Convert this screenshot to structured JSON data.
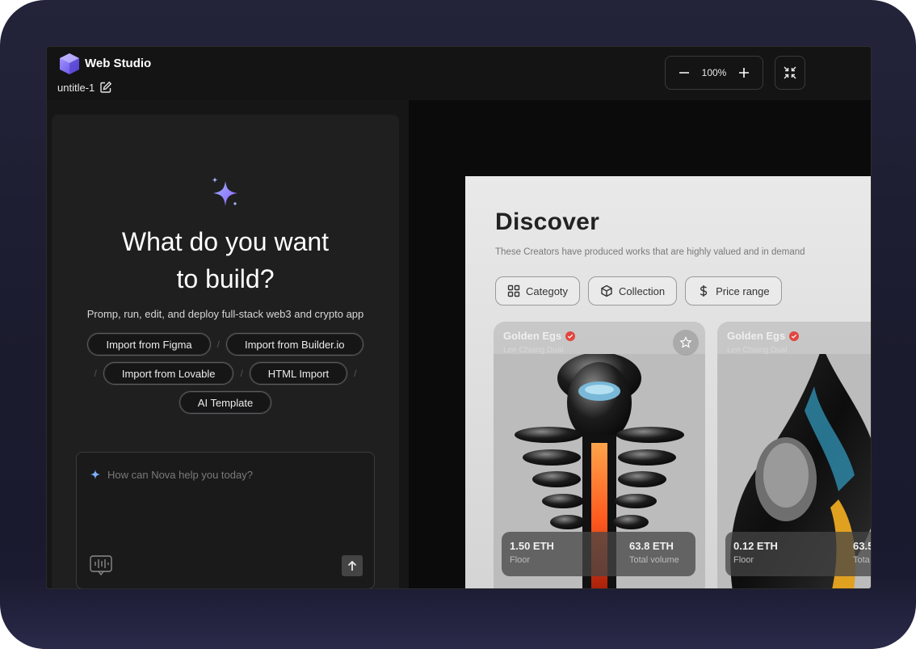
{
  "app": {
    "title": "Web Studio",
    "document_name": "untitle-1"
  },
  "toolbar": {
    "zoom_value": "100%"
  },
  "builder": {
    "heading_line1": "What do you want",
    "heading_line2": "to build?",
    "subtitle": "Promp, run, edit, and deploy full-stack web3 and crypto app",
    "separator": "/",
    "imports": [
      "Import from Figma",
      "Import from Builder.io",
      "Import from Lovable",
      "HTML Import",
      "AI Template"
    ],
    "prompt_placeholder": "How can Nova help you today?"
  },
  "preview": {
    "title": "Discover",
    "subtitle": "These Creators have produced works that are highly valued and in demand",
    "filters": [
      "Categoty",
      "Collection",
      "Price range"
    ],
    "cards": [
      {
        "name": "Golden Egs",
        "creator": "Lee Chiang Dual",
        "floor": "1.50 ETH",
        "floor_label": "Floor",
        "volume": "63.8 ETH",
        "volume_label": "Total volume"
      },
      {
        "name": "Golden Egs",
        "creator": "Lee Chiang Dual",
        "floor": "0.12 ETH",
        "floor_label": "Floor",
        "volume": "63.5",
        "volume_label": "Tota"
      }
    ]
  },
  "colors": {
    "accent": "#7b6cff",
    "panel": "#1f1f1f",
    "background": "#161616"
  }
}
